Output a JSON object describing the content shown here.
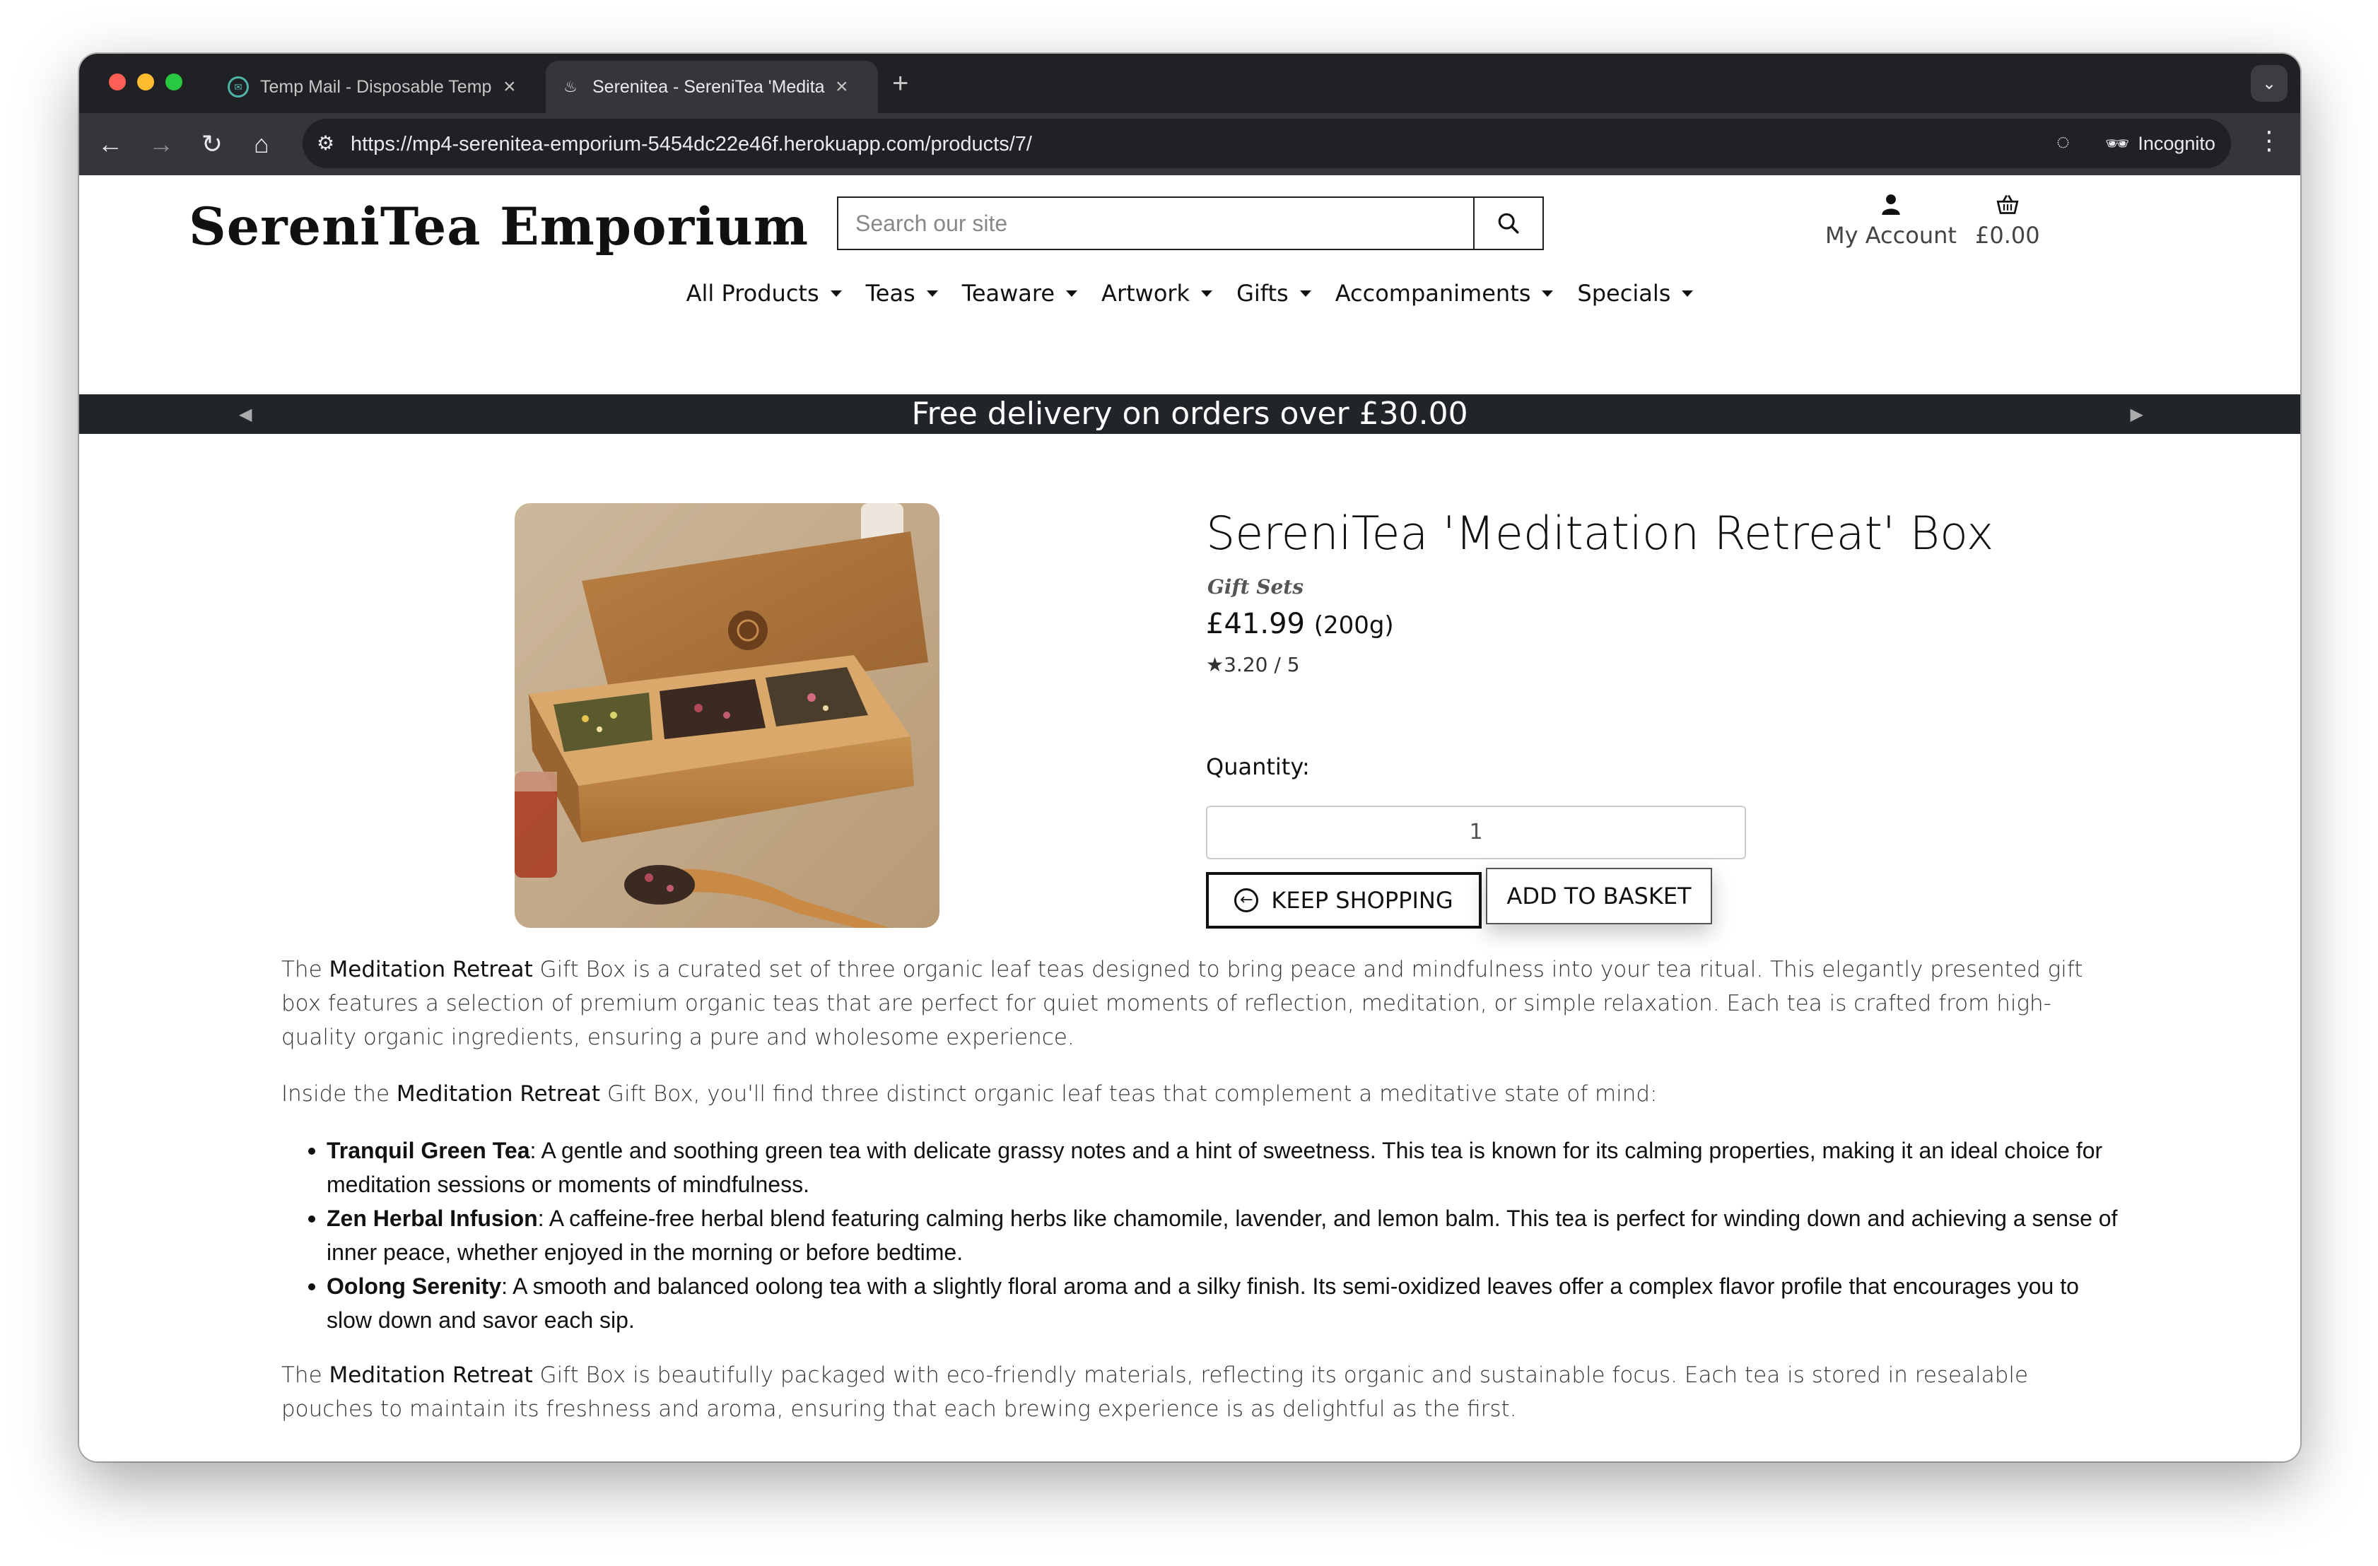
{
  "browser": {
    "tabs": [
      {
        "title": "Temp Mail - Disposable Temp",
        "favicon": "tempmail-icon"
      },
      {
        "title": "Serenitea - SereniTea 'Medita",
        "favicon": "teapot-icon",
        "active": true
      }
    ],
    "url": "https://mp4-serenitea-emporium-5454dc22e46f.herokuapp.com/products/7/",
    "incognito_label": "Incognito"
  },
  "site": {
    "brand": "SereniTea Emporium",
    "search_placeholder": "Search our site",
    "account_label": "My Account",
    "basket_total": "£0.00"
  },
  "nav": {
    "items": [
      "All Products",
      "Teas",
      "Teaware",
      "Artwork",
      "Gifts",
      "Accompaniments",
      "Specials"
    ]
  },
  "promo": {
    "text": "Free delivery on orders over £30.00"
  },
  "product": {
    "title": "SereniTea 'Meditation Retreat' Box",
    "category": "Gift Sets",
    "price": "£41.99",
    "size": "(200g)",
    "rating": "3.20 / 5",
    "quantity_label": "Quantity:",
    "quantity_value": "1",
    "keep_shopping_label": "KEEP SHOPPING",
    "add_to_basket_label": "ADD TO BASKET"
  },
  "description": {
    "p1": {
      "pre": "The ",
      "bold": "Meditation Retreat",
      "post": " Gift Box is a curated set of three organic leaf teas designed to bring peace and mindfulness into your tea ritual. This elegantly presented gift box features a selection of premium organic teas that are perfect for quiet moments of reflection, meditation, or simple relaxation. Each tea is crafted from high-quality organic ingredients, ensuring a pure and wholesome experience."
    },
    "p2": {
      "pre": "Inside the ",
      "bold": "Meditation Retreat",
      "post": " Gift Box, you'll find three distinct organic leaf teas that complement a meditative state of mind:"
    },
    "teas": [
      {
        "name": "Tranquil Green Tea",
        "text": ": A gentle and soothing green tea with delicate grassy notes and a hint of sweetness. This tea is known for its calming properties, making it an ideal choice for meditation sessions or moments of mindfulness."
      },
      {
        "name": "Zen Herbal Infusion",
        "text": ": A caffeine-free herbal blend featuring calming herbs like chamomile, lavender, and lemon balm. This tea is perfect for winding down and achieving a sense of inner peace, whether enjoyed in the morning or before bedtime."
      },
      {
        "name": "Oolong Serenity",
        "text": ": A smooth and balanced oolong tea with a slightly floral aroma and a silky finish. Its semi-oxidized leaves offer a complex flavor profile that encourages you to slow down and savor each sip."
      }
    ],
    "p3": {
      "pre": "The ",
      "bold": "Meditation Retreat",
      "post": " Gift Box is beautifully packaged with eco-friendly materials, reflecting its organic and sustainable focus. Each tea is stored in resealable pouches to maintain its freshness and aroma, ensuring that each brewing experience is as delightful as the first."
    }
  }
}
